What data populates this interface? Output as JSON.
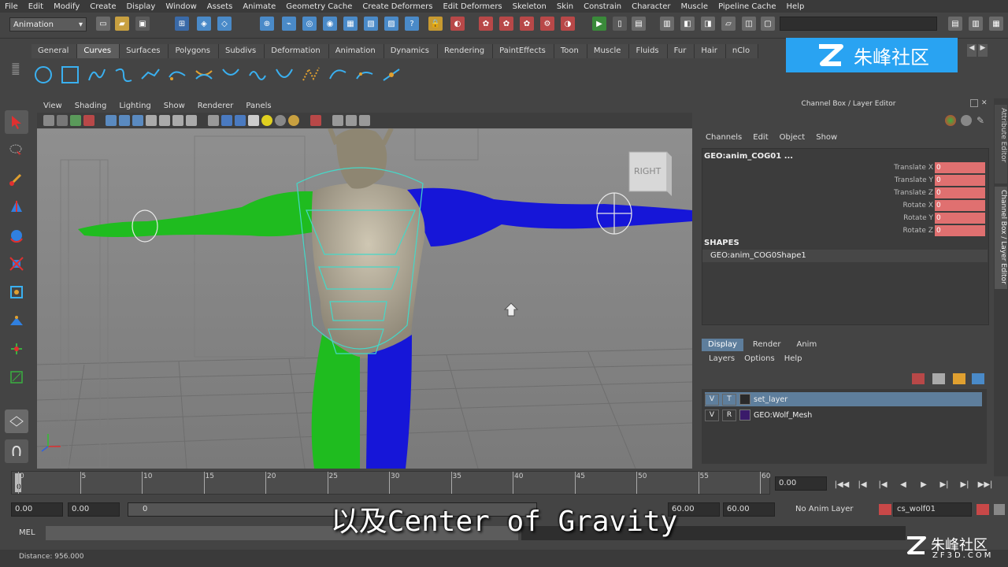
{
  "menubar": [
    "File",
    "Edit",
    "Modify",
    "Create",
    "Display",
    "Window",
    "Assets",
    "Animate",
    "Geometry Cache",
    "Create Deformers",
    "Edit Deformers",
    "Skeleton",
    "Skin",
    "Constrain",
    "Character",
    "Muscle",
    "Pipeline Cache",
    "Help"
  ],
  "status_line": {
    "mode": "Animation"
  },
  "shelf": {
    "tabs": [
      "General",
      "Curves",
      "Surfaces",
      "Polygons",
      "Subdivs",
      "Deformation",
      "Animation",
      "Dynamics",
      "Rendering",
      "PaintEffects",
      "Toon",
      "Muscle",
      "Fluids",
      "Fur",
      "Hair",
      "nClo"
    ],
    "active_tab": "Curves"
  },
  "viewport": {
    "menu": [
      "View",
      "Shading",
      "Lighting",
      "Show",
      "Renderer",
      "Panels"
    ],
    "view_cube_label": "RIGHT"
  },
  "channel_box": {
    "title": "Channel Box / Layer Editor",
    "menu": [
      "Channels",
      "Edit",
      "Object",
      "Show"
    ],
    "object_name": "GEO:anim_COG01 ...",
    "attributes": [
      {
        "label": "Translate X",
        "value": "0"
      },
      {
        "label": "Translate Y",
        "value": "0"
      },
      {
        "label": "Translate Z",
        "value": "0"
      },
      {
        "label": "Rotate X",
        "value": "0"
      },
      {
        "label": "Rotate Y",
        "value": "0"
      },
      {
        "label": "Rotate Z",
        "value": "0"
      }
    ],
    "shapes_header": "SHAPES",
    "shape_name": "GEO:anim_COG0Shape1"
  },
  "side_tabs": [
    "Attribute Editor",
    "Channel Box / Layer Editor"
  ],
  "layer_editor": {
    "tabs": [
      "Display",
      "Render",
      "Anim"
    ],
    "active_tab": "Display",
    "menu": [
      "Layers",
      "Options",
      "Help"
    ],
    "layers": [
      {
        "v": "V",
        "t": "T",
        "name": "set_layer",
        "color": "#2a2a2a",
        "selected": true
      },
      {
        "v": "V",
        "t": "R",
        "name": "GEO:Wolf_Mesh",
        "color": "#3a1a6a",
        "selected": false
      }
    ]
  },
  "timeline": {
    "ticks": [
      "0",
      "5",
      "10",
      "15",
      "20",
      "25",
      "30",
      "35",
      "40",
      "45",
      "50",
      "55",
      "60"
    ],
    "current_frame": "0",
    "current_time_field": "0.00"
  },
  "range": {
    "start_time": "0.00",
    "start_playback": "0.00",
    "range_start_label": "0",
    "end_playback": "60.00",
    "end_time": "60.00",
    "anim_layer": "No Anim Layer",
    "character_set": "cs_wolf01"
  },
  "command_line": {
    "label": "MEL"
  },
  "help_line": {
    "text": "Distance: 956.000"
  },
  "subtitle": "以及Center of Gravity",
  "watermark_top": "朱峰社区",
  "watermark_bottom": {
    "text": "朱峰社区",
    "url": "ZF3D.COM"
  },
  "colors": {
    "green_mesh": "#22c020",
    "blue_mesh": "#1414e0",
    "attr_red": "#e07070",
    "layer_selected": "#5e7e9c"
  }
}
